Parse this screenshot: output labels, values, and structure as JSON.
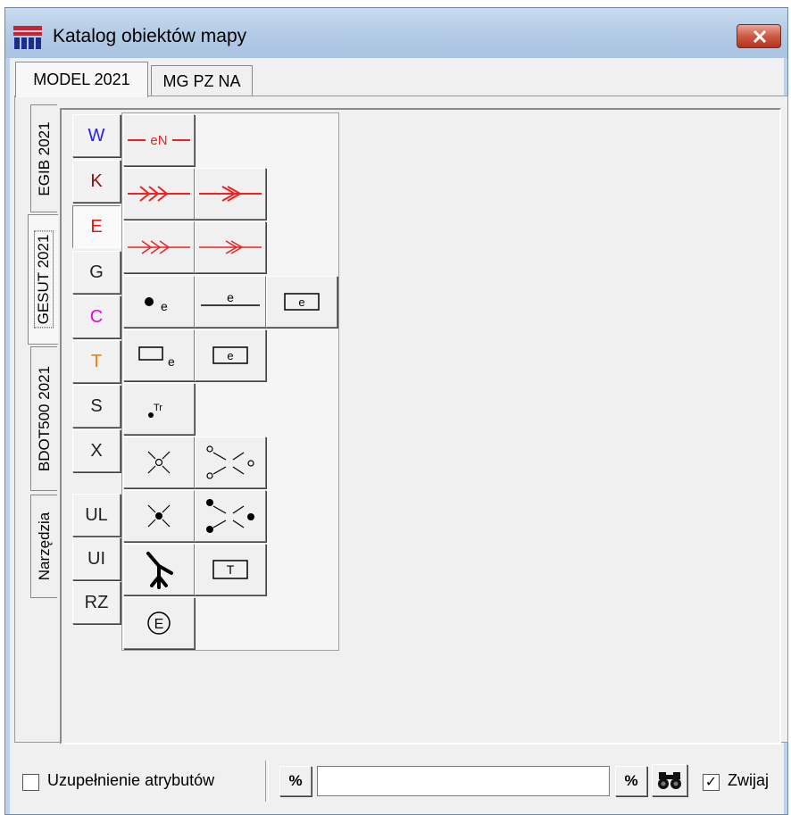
{
  "window": {
    "title": "Katalog obiektów mapy",
    "close_label": "✕"
  },
  "top_tabs": [
    {
      "label": "MODEL 2021",
      "active": true
    },
    {
      "label": "MG PZ NA",
      "active": false
    }
  ],
  "side_tabs": [
    {
      "label": "EGIB 2021",
      "active": false
    },
    {
      "label": "GESUT 2021",
      "active": true
    },
    {
      "label": "BDOT500 2021",
      "active": false
    },
    {
      "label": "Narzędzia",
      "active": false
    }
  ],
  "letter_buttons": [
    {
      "label": "W",
      "color": "#2222ee"
    },
    {
      "label": "K",
      "color": "#8b1010"
    },
    {
      "label": "E",
      "color": "#ee1111",
      "active": true
    },
    {
      "label": "G",
      "color": "#222222"
    },
    {
      "label": "C",
      "color": "#ee00ee"
    },
    {
      "label": "T",
      "color": "#f08000"
    },
    {
      "label": "S",
      "color": "#222222"
    },
    {
      "label": "X",
      "color": "#222222"
    },
    {
      "label": "UL",
      "color": "#222222"
    },
    {
      "label": "UI",
      "color": "#222222"
    },
    {
      "label": "RZ",
      "color": "#222222"
    }
  ],
  "symbols": {
    "line_eN": "eN",
    "letter_e": "e",
    "letter_T": "T",
    "letter_Tr": "Tr",
    "circle_E": "E",
    "line_color": "#ee2222"
  },
  "bottom": {
    "checkbox_label": "Uzupełnienie atrybutów",
    "checkbox_checked": false,
    "percent_left": "%",
    "search_value": "",
    "percent_right": "%",
    "binoculars": "binoculars-icon",
    "collapse_label": "Zwijaj",
    "collapse_checked": true,
    "check_mark": "✓"
  }
}
